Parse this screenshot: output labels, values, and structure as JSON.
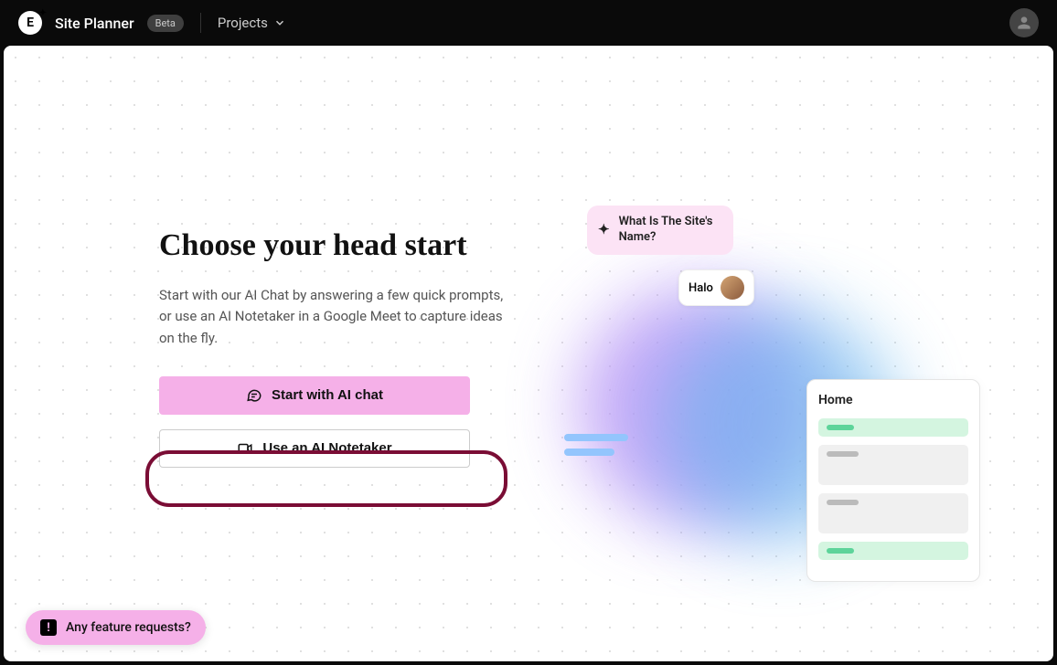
{
  "header": {
    "app_name": "Site Planner",
    "badge": "Beta",
    "projects_label": "Projects"
  },
  "main": {
    "headline": "Choose your head start",
    "description": "Start with our AI Chat by answering a few quick prompts, or use an AI Notetaker in a Google Meet to capture ideas on the fly.",
    "primary_button": "Start with AI chat",
    "secondary_button": "Use an AI Notetaker"
  },
  "illustration": {
    "ai_bubble": "What Is The Site's Name?",
    "user_bubble": "Halo",
    "card_title": "Home"
  },
  "feedback": {
    "label": "Any feature requests?"
  }
}
